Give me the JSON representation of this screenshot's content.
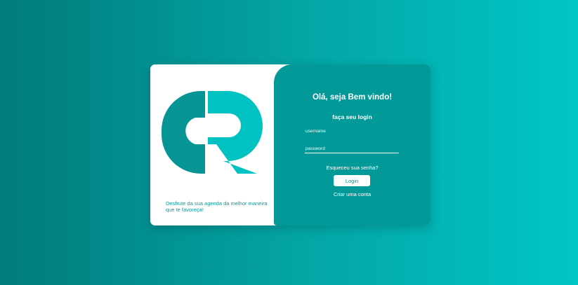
{
  "colors": {
    "brand_teal": "#039999",
    "logo_dark_teal": "#069494",
    "logo_light_teal": "#00c2c2",
    "background_start": "#017b7b",
    "background_end": "#00c6c6"
  },
  "brand": {
    "logo_icon": "cr-logo-icon",
    "tagline": "Desfrute da sua agenda da melhor maneira que te favoreça!"
  },
  "login": {
    "welcome": "Olá, seja Bem vindo!",
    "subtitle": "faça seu login",
    "username_placeholder": "username",
    "password_placeholder": "password",
    "forgot_password": "Esqueceu sua senha?",
    "login_button": "Login",
    "create_account": "Criar uma conta"
  }
}
